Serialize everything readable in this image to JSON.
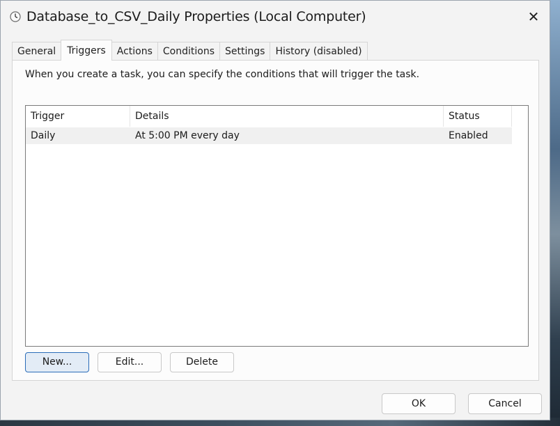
{
  "window": {
    "title": "Database_to_CSV_Daily Properties (Local Computer)",
    "title_icon": "clock-icon",
    "close_icon": "close-icon",
    "close_glyph": "✕"
  },
  "tabs": [
    {
      "label": "General"
    },
    {
      "label": "Triggers",
      "active": true
    },
    {
      "label": "Actions"
    },
    {
      "label": "Conditions"
    },
    {
      "label": "Settings"
    },
    {
      "label": "History (disabled)"
    }
  ],
  "triggers_page": {
    "intro": "When you create a task, you can specify the conditions that will trigger the task.",
    "columns": [
      "Trigger",
      "Details",
      "Status"
    ],
    "rows": [
      {
        "trigger": "Daily",
        "details": "At 5:00 PM every day",
        "status": "Enabled"
      }
    ],
    "buttons": {
      "new": "New...",
      "edit": "Edit...",
      "delete": "Delete"
    }
  },
  "footer": {
    "ok": "OK",
    "cancel": "Cancel"
  },
  "colors": {
    "window_bg": "#f3f3f3",
    "accent": "#2a6cb8",
    "selected_row": "#f0f0f0"
  }
}
